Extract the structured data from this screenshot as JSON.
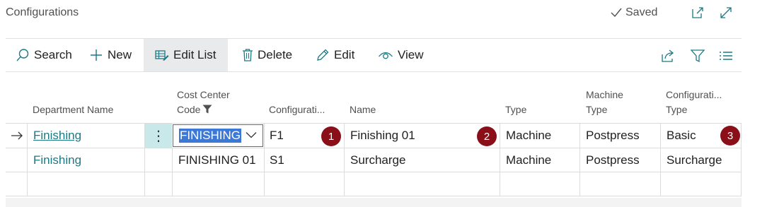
{
  "page": {
    "title": "Configurations",
    "saved_label": "Saved"
  },
  "actions": {
    "search": "Search",
    "new": "New",
    "edit_list": "Edit List",
    "delete": "Delete",
    "edit": "Edit",
    "view": "View"
  },
  "columns": {
    "department_name": "Department Name",
    "cost_center_code_line1": "Cost Center",
    "cost_center_code_line2": "Code",
    "configuration": "Configurati...",
    "name": "Name",
    "type": "Type",
    "machine_type_line1": "Machine",
    "machine_type_line2": "Type",
    "configuration_type_line1": "Configurati...",
    "configuration_type_line2": "Type"
  },
  "rows": [
    {
      "department": "Finishing",
      "cost_center": "FINISHING",
      "configuration": "F1",
      "name": "Finishing 01",
      "type": "Machine",
      "machine_type": "Postpress",
      "configuration_type": "Basic"
    },
    {
      "department": "Finishing",
      "cost_center": "FINISHING 01",
      "configuration": "S1",
      "name": "Surcharge",
      "type": "Machine",
      "machine_type": "Postpress",
      "configuration_type": "Surcharge"
    }
  ],
  "callouts": [
    "1",
    "2",
    "3"
  ],
  "colors": {
    "link": "#1a7a84",
    "selected_text_bg": "#3b78d8",
    "active_cell": "#c9e8ea",
    "callout": "#8b0f18",
    "active_action": "#e8eaec"
  },
  "icons": [
    "check-icon",
    "open-in-new-window-icon",
    "expand-icon",
    "search-icon",
    "plus-icon",
    "edit-list-icon",
    "trash-icon",
    "pencil-icon",
    "eye-icon",
    "share-icon",
    "filter-icon",
    "list-icon",
    "row-arrow-icon",
    "more-options-icon",
    "chevron-down-icon",
    "funnel-icon"
  ]
}
